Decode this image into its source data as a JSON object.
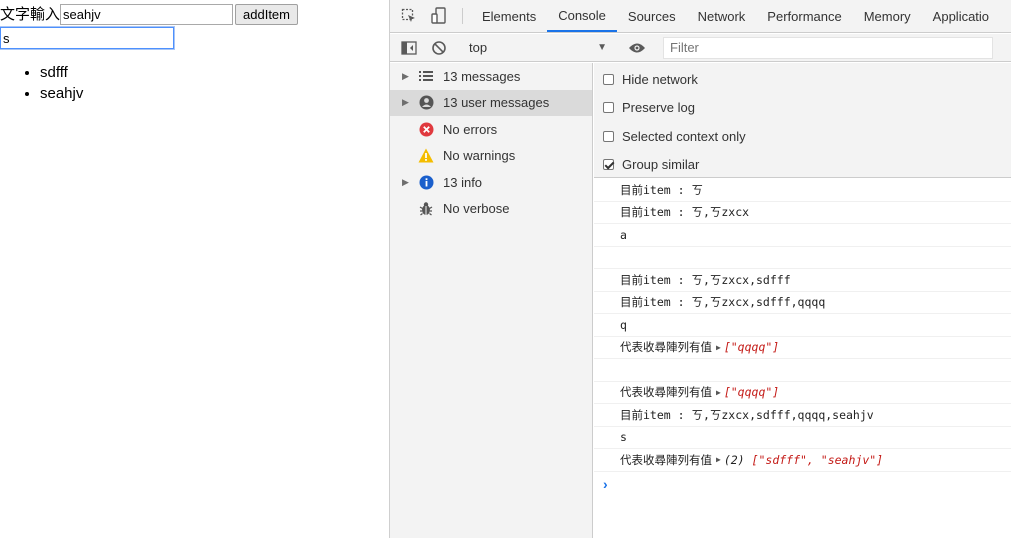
{
  "page": {
    "label": "文字輸入",
    "main_input_value": "seahjv",
    "add_button_label": "addItem",
    "search_input_value": "s",
    "items": [
      "sdfff",
      "seahjv"
    ]
  },
  "devtools": {
    "tabs": [
      "Elements",
      "Console",
      "Sources",
      "Network",
      "Performance",
      "Memory",
      "Applicatio"
    ],
    "active_tab": "Console",
    "context": "top",
    "filter_placeholder": "Filter",
    "sidebar": [
      {
        "label": "13 messages",
        "icon": "list-icon",
        "expandable": true
      },
      {
        "label": "13 user messages",
        "icon": "user-icon",
        "expandable": true,
        "selected": true
      },
      {
        "label": "No errors",
        "icon": "error-icon",
        "expandable": false
      },
      {
        "label": "No warnings",
        "icon": "warning-icon",
        "expandable": false
      },
      {
        "label": "13 info",
        "icon": "info-icon",
        "expandable": true
      },
      {
        "label": "No verbose",
        "icon": "bug-icon",
        "expandable": false
      }
    ],
    "settings": [
      {
        "label": "Hide network",
        "checked": false
      },
      {
        "label": "Preserve log",
        "checked": false
      },
      {
        "label": "Selected context only",
        "checked": false
      },
      {
        "label": "Group similar",
        "checked": true
      }
    ],
    "messages": [
      {
        "text": "目前item : ㄎ"
      },
      {
        "text": "目前item : ㄎ,ㄎzxcx"
      },
      {
        "text": "a"
      },
      {
        "text": ""
      },
      {
        "text": "目前item : ㄎ,ㄎzxcx,sdfff"
      },
      {
        "text": "目前item : ㄎ,ㄎzxcx,sdfff,qqqq"
      },
      {
        "text": "q"
      },
      {
        "text": "代表收尋陣列有值",
        "array": "[\"qqqq\"]"
      },
      {
        "text": ""
      },
      {
        "text": "代表收尋陣列有值",
        "array": "[\"qqqq\"]"
      },
      {
        "text": "目前item : ㄎ,ㄎzxcx,sdfff,qqqq,seahjv"
      },
      {
        "text": "s"
      },
      {
        "text": "代表收尋陣列有值",
        "array_prefix": "(2)",
        "array": "[\"sdfff\", \"seahjv\"]"
      }
    ]
  }
}
